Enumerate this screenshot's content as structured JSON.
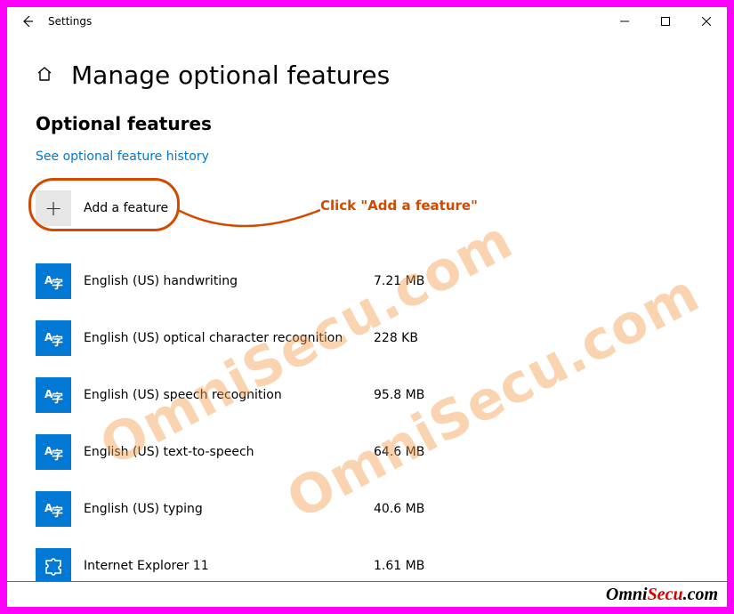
{
  "window": {
    "title": "Settings"
  },
  "page": {
    "heading": "Manage optional features",
    "section_title": "Optional features",
    "history_link": "See optional feature history",
    "add_feature_label": "Add a feature"
  },
  "callout": {
    "text": "Click \"Add a feature\""
  },
  "features": [
    {
      "name": "English (US) handwriting",
      "size": "7.21 MB",
      "icon": "lang"
    },
    {
      "name": "English (US) optical character recognition",
      "size": "228 KB",
      "icon": "lang"
    },
    {
      "name": "English (US) speech recognition",
      "size": "95.8 MB",
      "icon": "lang"
    },
    {
      "name": "English (US) text-to-speech",
      "size": "64.6 MB",
      "icon": "lang"
    },
    {
      "name": "English (US) typing",
      "size": "40.6 MB",
      "icon": "lang"
    },
    {
      "name": "Internet Explorer 11",
      "size": "1.61 MB",
      "icon": "puzzle"
    }
  ],
  "watermark": "OmniSecu.com",
  "brand": {
    "part1": "Omni",
    "part2": "Secu",
    "part3": ".com"
  }
}
